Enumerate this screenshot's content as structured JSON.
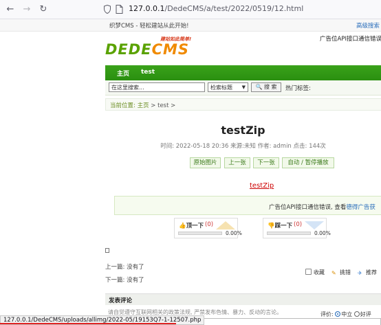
{
  "browser": {
    "back_icon": "arrow-left-icon",
    "forward_icon": "arrow-right-icon",
    "reload_icon": "reload-icon",
    "url_host": "127.0.0.1",
    "url_path": "/DedeCMS/a/test/2022/0519/12.html"
  },
  "topbar": {
    "welcome": "织梦CMS - 轻松建站从此开始!",
    "advanced_search": "高级搜索"
  },
  "header": {
    "logo_slogan": "建站如此简单!",
    "logo_word_a": "DEDE",
    "logo_word_b": "CMS",
    "ad_text": "广告位API接口通信错误,"
  },
  "nav": {
    "items": [
      "主页",
      "test"
    ]
  },
  "search": {
    "placeholder": "在这里搜索...",
    "type_selected": "检索标题",
    "button_label": "搜 索",
    "hot_label": "热门标签:"
  },
  "breadcrumb": {
    "prefix": "当前位置:",
    "home": "主页",
    "sep": ">",
    "current": "test",
    "trail_sep": ">"
  },
  "article": {
    "title": "testZip",
    "meta": "时间: 2022-05-18 20:36 来源:未知 作者: admin 点击: 144次",
    "buttons": [
      "原始图片",
      "上一张",
      "下一张",
      "自动 / 暂停播放"
    ],
    "zip_link": "testZip",
    "ad_text_a": "广告位API接口通信错误, 查看",
    "ad_text_link": "德得广告获"
  },
  "votes": {
    "up": {
      "label": "顶一下",
      "count": "(0)",
      "percent": "0.00%",
      "fill": 0
    },
    "down": {
      "label": "踩一下",
      "count": "(0)",
      "percent": "0.00%",
      "fill": 0
    }
  },
  "pager": {
    "prev": "上一篇: 没有了",
    "next": "下一篇: 没有了"
  },
  "actions": {
    "favorite": "收藏",
    "report": "挑错",
    "recommend": "推荐"
  },
  "comments": {
    "heading": "发表评论",
    "notice": "请自觉遵守互联网相关的政策法规, 严禁发布色情、暴力、反动的言论。",
    "rating_label": "评价:",
    "rating_options": [
      "中立",
      "好评"
    ]
  },
  "status": {
    "link_url": "127.0.0.1/DedeCMS/uploads/allimg/2022-05/19153Q7-1-12507.php"
  },
  "colors": {
    "nav_green": "#2a8f10",
    "logo_green": "#5aa200",
    "logo_orange": "#f08a00",
    "link_red": "#cc0000",
    "status_underline": "#e02020"
  }
}
